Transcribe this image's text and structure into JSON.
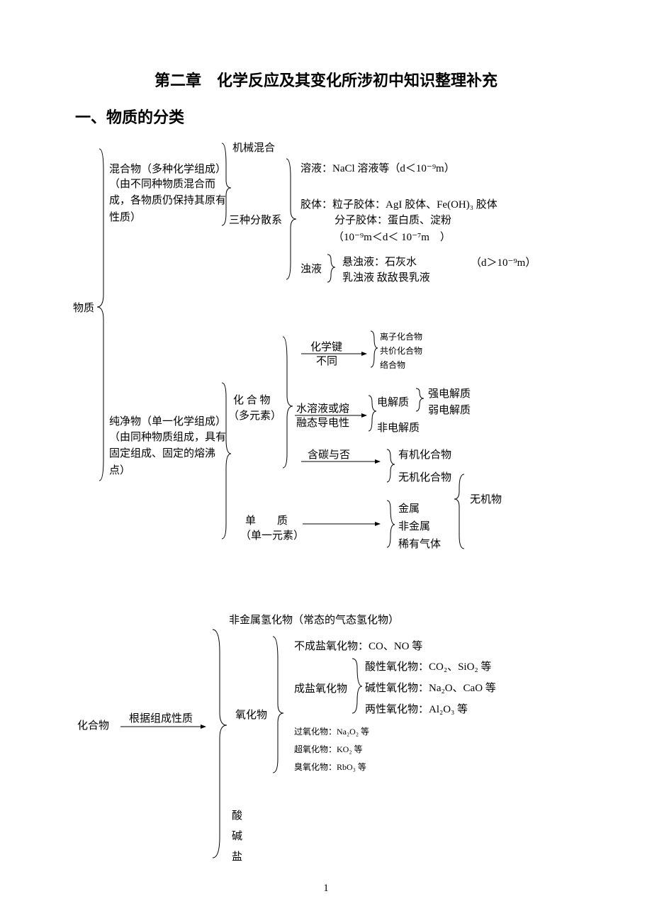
{
  "title": "第二章　化学反应及其变化所涉初中知识整理补充",
  "section1": "一、物质的分类",
  "root": "物质",
  "mix": {
    "head": "混合物（多种化学组成）",
    "desc": "（由不同种物质混合而成，各物质仍保持其原有性质）",
    "mech": "机械混合",
    "disp_label": "三种分散系",
    "sol": "溶液：NaCl 溶液等（d＜10⁻⁹m）",
    "col1": "胶体：粒子胶体：AgI 胶体、Fe(OH)₃ 胶体",
    "col2": "分子胶体：蛋白质、淀粉",
    "col3": "（10⁻⁹m＜d＜ 10⁻⁷m　）",
    "turb_label": "浊液",
    "turb1": "悬浊液：石灰水",
    "turb2": "乳浊液  敌敌畏乳液",
    "turb_d": "（d＞10⁻⁹m）"
  },
  "pure": {
    "head": "纯净物（单一化学组成）",
    "desc": "（由同种物质组成，具有固定组成、固定的熔沸点）",
    "compound_label": "化 合 物",
    "compound_sub": "（多元素）",
    "bond_top": "化学键",
    "bond_bot": "不同",
    "bond1": "离子化合物",
    "bond2": "共价化合物",
    "bond3": "络合物",
    "cond_top": "水溶液或熔",
    "cond_bot": "融态导电性",
    "elec": "电解质",
    "strong": "强电解质",
    "weak": "弱电解质",
    "nonelec": "非电解质",
    "carbon": "含碳与否",
    "org": "有机化合物",
    "inorg": "无机化合物",
    "element_label": "单　　质",
    "element_sub": "（单一元素）",
    "metal": "金属",
    "nonmetal": "非金属",
    "noble": "稀有气体",
    "inorg_label": "无机物"
  },
  "comp2": {
    "root": "化合物",
    "arrow_label": "根据组成性质",
    "hydride": "非金属氢化物（常态的气态氢化物）",
    "oxide_label": "氧化物",
    "nonsalt": "不成盐氧化物：CO、NO 等",
    "salt_label": "成盐氧化物",
    "acidic": "酸性氧化物：CO₂、SiO₂ 等",
    "basic": "碱性氧化物：Na₂O、CaO 等",
    "ampho": "两性氧化物：Al₂O₃ 等",
    "perox": "过氧化物：Na₂O₂ 等",
    "superox": "超氧化物：KO₂ 等",
    "ozon": "臭氧化物：RbO₃ 等",
    "acid": "酸",
    "base": "碱",
    "salt": "盐"
  },
  "pagenum": "1"
}
